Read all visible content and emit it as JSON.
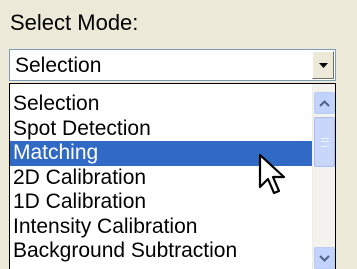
{
  "label": "Select Mode:",
  "combo": {
    "value": "Selection",
    "button_icon": "dropdown-arrow-icon"
  },
  "list": {
    "items": [
      {
        "label": "Selection",
        "selected": false
      },
      {
        "label": "Spot Detection",
        "selected": false
      },
      {
        "label": "Matching",
        "selected": true
      },
      {
        "label": "2D Calibration",
        "selected": false
      },
      {
        "label": "1D Calibration",
        "selected": false
      },
      {
        "label": "Intensity Calibration",
        "selected": false
      },
      {
        "label": "Background Subtraction",
        "selected": false
      }
    ]
  },
  "scrollbar": {
    "up_icon": "scroll-up-icon",
    "down_icon": "scroll-down-icon",
    "thumb_icon": "scroll-thumb-grip-icon"
  },
  "cursor_icon": "mouse-pointer-icon",
  "colors": {
    "selection": "#316ac5",
    "window_bg": "#ece9d8",
    "combo_border": "#7f9db9",
    "scrollbar_button": "#c1d3fb"
  }
}
